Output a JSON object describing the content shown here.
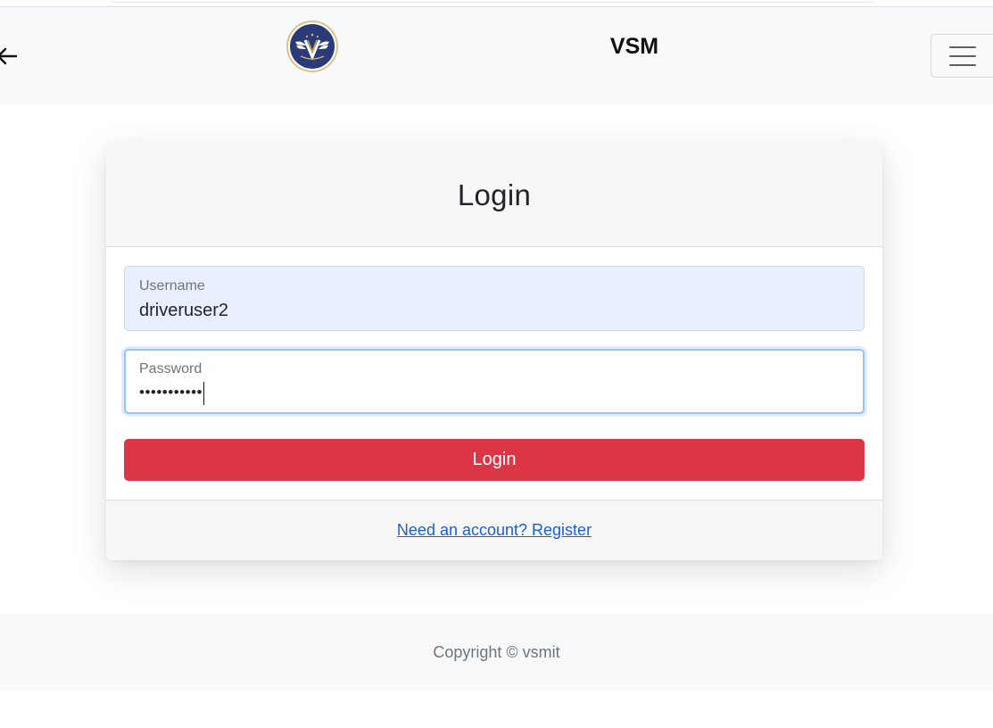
{
  "navbar": {
    "back_icon": "arrow-left-icon",
    "logo_icon": "vsm-logo",
    "brand": "VSM",
    "menu_icon": "hamburger-menu-icon"
  },
  "login_card": {
    "title": "Login",
    "username": {
      "label": "Username",
      "value": "driveruser2"
    },
    "password": {
      "label": "Password",
      "masked_value": "•••••••••••"
    },
    "submit_label": "Login",
    "register_link": "Need an account? Register"
  },
  "footer": {
    "copyright": "Copyright © vsmit"
  },
  "colors": {
    "primary_button": "#dc3545",
    "link": "#1a5fd6",
    "navbar_bg": "#f8f9fa",
    "autofill_bg": "#e8f0fe",
    "logo_navy": "#2b3a78"
  }
}
